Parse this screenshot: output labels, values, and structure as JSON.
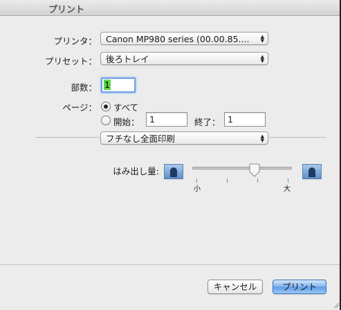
{
  "window": {
    "title": "プリント"
  },
  "printer": {
    "label": "プリンタ：",
    "value": "Canon MP980 series (00.00.85...."
  },
  "preset": {
    "label": "プリセット：",
    "value": "後ろトレイ"
  },
  "copies": {
    "label": "部数：",
    "value": "1"
  },
  "pages": {
    "label": "ページ：",
    "all_label": "すべて",
    "all_selected": true,
    "range_label": "開始：",
    "from_value": "1",
    "to_label": "終了：",
    "to_value": "1"
  },
  "section": {
    "value": "フチなし全面印刷"
  },
  "extension": {
    "label": "はみ出し量:",
    "min_label": "小",
    "max_label": "大",
    "level_fraction": 0.64,
    "tick_count": 4
  },
  "buttons": {
    "cancel": "キャンセル",
    "print": "プリント"
  },
  "colors": {
    "accent": "#5b9be8",
    "selection": "#5cd648"
  }
}
